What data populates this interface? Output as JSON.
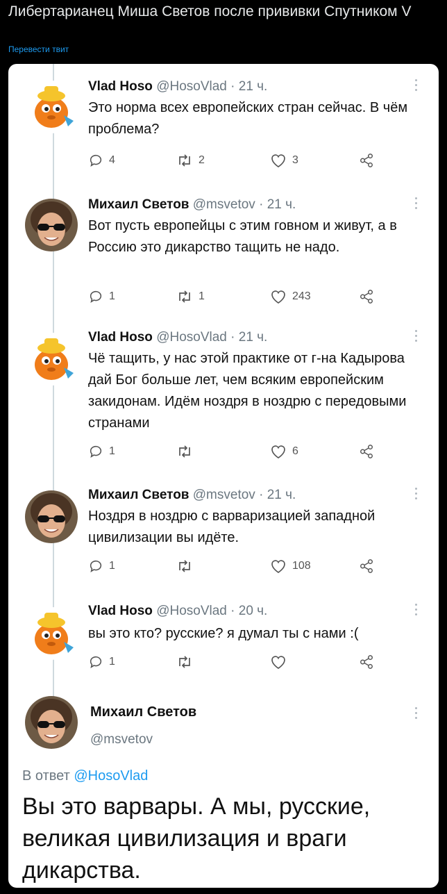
{
  "post": {
    "title": "Либертарианец Миша Светов после прививки Спутником V",
    "translate_label": "Перевести твит"
  },
  "tweets": [
    {
      "name": "Vlad Hoso",
      "handle": "@HosoVlad",
      "sep": "·",
      "time": "21 ч.",
      "text": "Это норма всех европейских стран сейчас. В чём проблема?",
      "replies": "4",
      "retweets": "2",
      "likes": "3",
      "avatar": "orange-bear-cartoon"
    },
    {
      "name": "Михаил Светов",
      "handle": "@msvetov",
      "sep": "·",
      "time": "21 ч.",
      "text": "Вот пусть европейцы с этим говном и живут, а в Россию это дикарство тащить не надо.",
      "replies": "1",
      "retweets": "1",
      "likes": "243",
      "avatar": "man-sunglasses-photo"
    },
    {
      "name": "Vlad Hoso",
      "handle": "@HosoVlad",
      "sep": "·",
      "time": "21 ч.",
      "text": "Чё тащить, у нас этой практике от г-на Кадырова дай Бог больше лет, чем всяким европейским закидонам. Идём ноздря в ноздрю с передовыми странами",
      "replies": "1",
      "retweets": "",
      "likes": "6",
      "avatar": "orange-bear-cartoon"
    },
    {
      "name": "Михаил Светов",
      "handle": "@msvetov",
      "sep": "·",
      "time": "21 ч.",
      "text": "Ноздря в ноздрю с варваризацией западной цивилизации вы идёте.",
      "replies": "1",
      "retweets": "",
      "likes": "108",
      "avatar": "man-sunglasses-photo"
    },
    {
      "name": "Vlad Hoso",
      "handle": "@HosoVlad",
      "sep": "·",
      "time": "20 ч.",
      "text": "вы это кто? русские? я думал ты с нами :(",
      "replies": "1",
      "retweets": "",
      "likes": "",
      "avatar": "orange-bear-cartoon"
    }
  ],
  "main_tweet": {
    "name": "Михаил Светов",
    "handle": "@msvetov",
    "reply_prefix": "В ответ",
    "reply_to": "@HosoVlad",
    "text": "Вы это варвары. А мы, русские, великая цивилизация и враги дикарства.",
    "avatar": "man-sunglasses-photo"
  },
  "colors": {
    "background": "#000000",
    "card": "#ffffff",
    "link": "#1d9bf0",
    "muted": "#6b7780"
  }
}
